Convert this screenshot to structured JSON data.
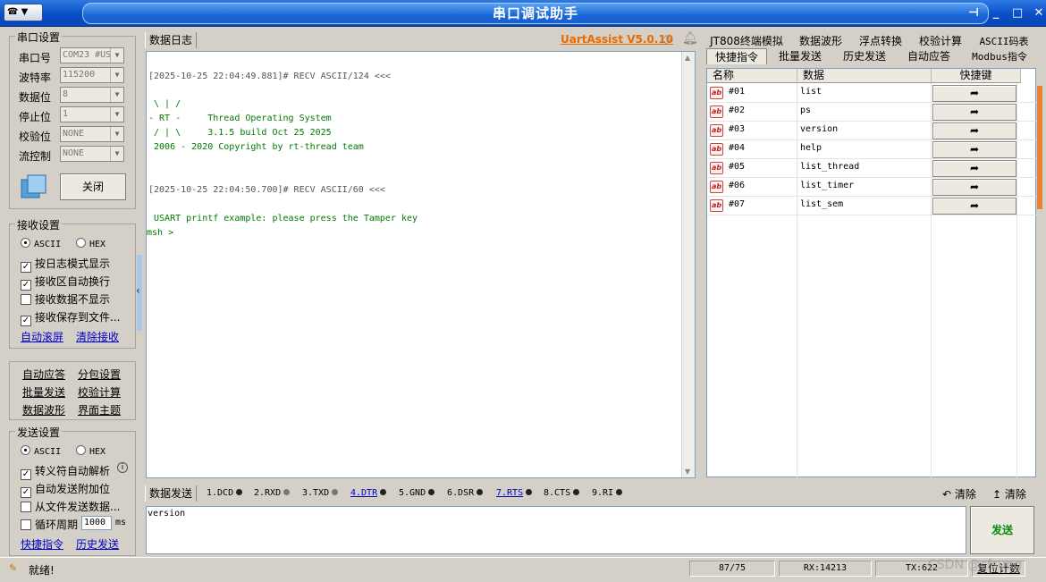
{
  "window": {
    "title": "串口调试助手",
    "menu_label": "▼",
    "controls": {
      "pin": "⊣",
      "minimize": "_",
      "maximize": "□",
      "close": "✕"
    }
  },
  "serial_settings": {
    "title": "串口设置",
    "port_label": "串口号",
    "port_value": "COM23 #US",
    "baud_label": "波特率",
    "baud_value": "115200",
    "databits_label": "数据位",
    "databits_value": "8",
    "stopbits_label": "停止位",
    "stopbits_value": "1",
    "parity_label": "校验位",
    "parity_value": "NONE",
    "flow_label": "流控制",
    "flow_value": "NONE",
    "close_button": "关闭"
  },
  "receive_settings": {
    "title": "接收设置",
    "ascii": "ASCII",
    "hex": "HEX",
    "opt1": "按日志模式显示",
    "opt2": "接收区自动换行",
    "opt3": "接收数据不显示",
    "opt4": "接收保存到文件...",
    "link_autoscroll": "自动滚屏",
    "link_clear": "清除接收"
  },
  "tools": {
    "auto_reply": "自动应答",
    "packet_settings": "分包设置",
    "batch_send": "批量发送",
    "checksum": "校验计算",
    "waveform": "数据波形",
    "theme": "界面主题"
  },
  "send_settings": {
    "title": "发送设置",
    "ascii": "ASCII",
    "hex": "HEX",
    "opt1": "转义符自动解析",
    "opt2": "自动发送附加位",
    "opt3": "从文件发送数据...",
    "opt4": "循环周期",
    "cycle_value": "1000",
    "cycle_unit": "ms",
    "link_quick": "快捷指令",
    "link_history": "历史发送"
  },
  "log": {
    "tab": "数据日志",
    "brand": "UartAssist V5.0.10",
    "lines": [
      {
        "text": "[2025-10-25 22:04:49.881]# RECV ASCII/124 <<<",
        "color": "gray"
      },
      {
        "text": " \\ | /",
        "color": "green"
      },
      {
        "text": "- RT -     Thread Operating System",
        "color": "green"
      },
      {
        "text": " / | \\     3.1.5 build Oct 25 2025",
        "color": "green"
      },
      {
        "text": " 2006 - 2020 Copyright by rt-thread team",
        "color": "green"
      },
      {
        "text": "[2025-10-25 22:04:50.700]# RECV ASCII/60 <<<",
        "color": "gray"
      },
      {
        "text": " USART printf example: please press the Tamper key",
        "color": "green"
      },
      {
        "text": "msh >",
        "color": "green"
      }
    ]
  },
  "right_tabs": {
    "row1": [
      "JT808终端模拟",
      "数据波形",
      "浮点转换",
      "校验计算",
      "ASCII码表"
    ],
    "row2": [
      "快捷指令",
      "批量发送",
      "历史发送",
      "自动应答",
      "Modbus指令"
    ]
  },
  "quick_table": {
    "headers": [
      "名称",
      "数据",
      "快捷键"
    ],
    "rows": [
      {
        "name": "#01",
        "data": "list"
      },
      {
        "name": "#02",
        "data": "ps"
      },
      {
        "name": "#03",
        "data": "version"
      },
      {
        "name": "#04",
        "data": "help"
      },
      {
        "name": "#05",
        "data": "list_thread"
      },
      {
        "name": "#06",
        "data": "list_timer"
      },
      {
        "name": "#07",
        "data": "list_sem"
      }
    ]
  },
  "send_area": {
    "tab": "数据发送",
    "signals": [
      "1.DCD",
      "2.RXD",
      "3.TXD",
      "4.DTR",
      "5.GND",
      "6.DSR",
      "7.RTS",
      "8.CTS",
      "9.RI"
    ],
    "clear1": "清除",
    "clear2": "清除",
    "input_value": "version",
    "send_button": "发送"
  },
  "status": {
    "ready": "就绪!",
    "counter": "87/75",
    "rx": "RX:14213",
    "tx": "TX:622",
    "reset": "复位计数",
    "watermark": "CSDN @cfsung"
  }
}
